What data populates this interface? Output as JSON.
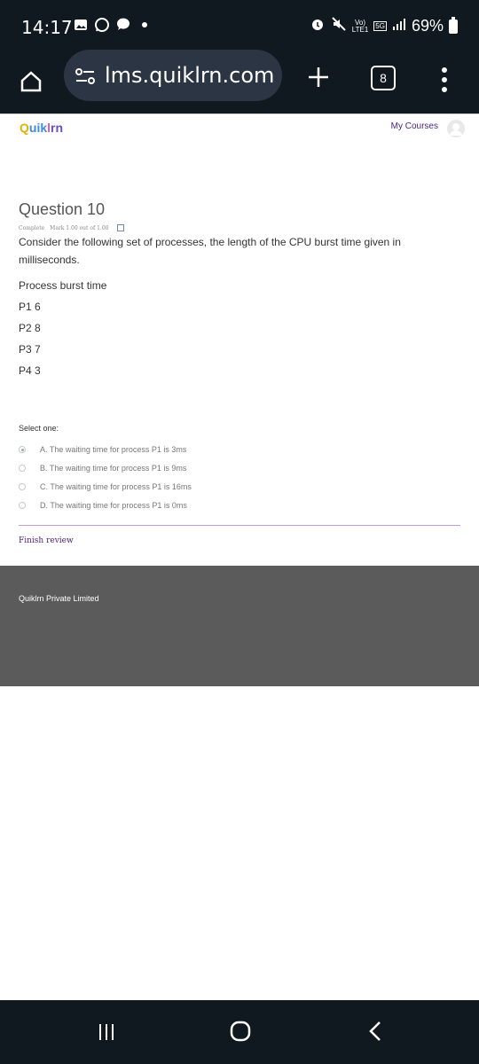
{
  "status_bar": {
    "time": "14:17",
    "network_label_1": "Vo)",
    "network_label_2": "LTE1",
    "network_5g": "5G",
    "battery": "69%",
    "icons": [
      "gallery-icon",
      "whatsapp-icon",
      "chat-icon",
      "alarm-icon",
      "mute-icon",
      "signal-icon",
      "battery-icon"
    ]
  },
  "browser": {
    "url": "lms.quiklrn.com/q",
    "tabs_count": "8",
    "icons": [
      "home-icon",
      "tune-icon",
      "plus-icon",
      "tabs-icon",
      "more-icon"
    ]
  },
  "site": {
    "logo": {
      "p1": "Q",
      "p2": "uik",
      "p3": "l",
      "p4": "rn"
    },
    "my_courses": "My Courses"
  },
  "question": {
    "title": "Question 10",
    "status": "Complete",
    "mark": "Mark 1.00 out of 1.00",
    "text": "Consider the following set of processes, the length of the CPU burst time given in milliseconds.",
    "table_header": "Process burst time",
    "rows": [
      "P1 6",
      "P2 8",
      "P3 7",
      "P4 3"
    ]
  },
  "answer": {
    "label": "Select one:",
    "options": [
      {
        "text": "A. The waiting time for process P1 is 3ms",
        "selected": true
      },
      {
        "text": "B. The waiting time for process P1 is 9ms",
        "selected": false
      },
      {
        "text": "C. The waiting time for process P1 is 16ms",
        "selected": false
      },
      {
        "text": "D. The waiting time for process P1 is 0ms",
        "selected": false
      }
    ]
  },
  "finish_review": "Finish review",
  "footer": {
    "company": "Quiklrn Private Limited"
  },
  "colors": {
    "accent": "#4b1f7d",
    "bar": "#101820",
    "footer": "#5b5b5b"
  }
}
